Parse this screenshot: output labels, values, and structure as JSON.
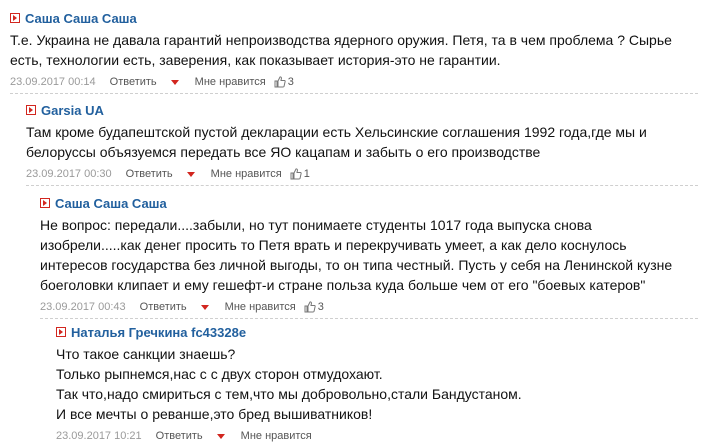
{
  "comments": [
    {
      "author": "Саша Саша Саша",
      "lines": [
        "Т.е. Украина не давала гарантий непроизводства ядерного оружия. Петя, та в чем проблема ? Сырье",
        "есть, технологии есть, заверения, как показывает история-это не гарантии."
      ],
      "date": "23.09.2017 00:14",
      "reply": "Ответить",
      "like": "Мне нравится",
      "likes": "3"
    },
    {
      "author": "Garsia UA",
      "lines": [
        "Там кроме будапештской пустой декларации есть Хельсинские соглашения 1992 года,где мы и",
        "белоруссы объязуемся передать все ЯО кацапам и забыть о его производстве"
      ],
      "date": "23.09.2017 00:30",
      "reply": "Ответить",
      "like": "Мне нравится",
      "likes": "1"
    },
    {
      "author": "Саша Саша Саша",
      "lines": [
        "Не вопрос: передали....забыли, но тут понимаете студенты 1017 года выпуска снова",
        "изобрели.....как денег просить то Петя врать и перекручивать умеет, а как дело коснулось",
        "интересов государства без личной выгоды, то он типа честный. Пусть у себя на Ленинской кузне",
        "боеголовки клипает и ему гешефт-и стране польза куда больше чем от его \"боевых катеров\""
      ],
      "date": "23.09.2017 00:43",
      "reply": "Ответить",
      "like": "Мне нравится",
      "likes": "3"
    },
    {
      "author": "Наталья Гречкина fc43328e",
      "lines": [
        "Что такое санкции знаешь?",
        "Только рыпнемся,нас с с двух сторон отмудохают.",
        "Так что,надо смириться с тем,что мы добровольно,стали Бандустаном.",
        "И все мечты о реванше,это бред вышиватников!"
      ],
      "date": "23.09.2017 10:21",
      "reply": "Ответить",
      "like": "Мне нравится",
      "likes": ""
    }
  ]
}
